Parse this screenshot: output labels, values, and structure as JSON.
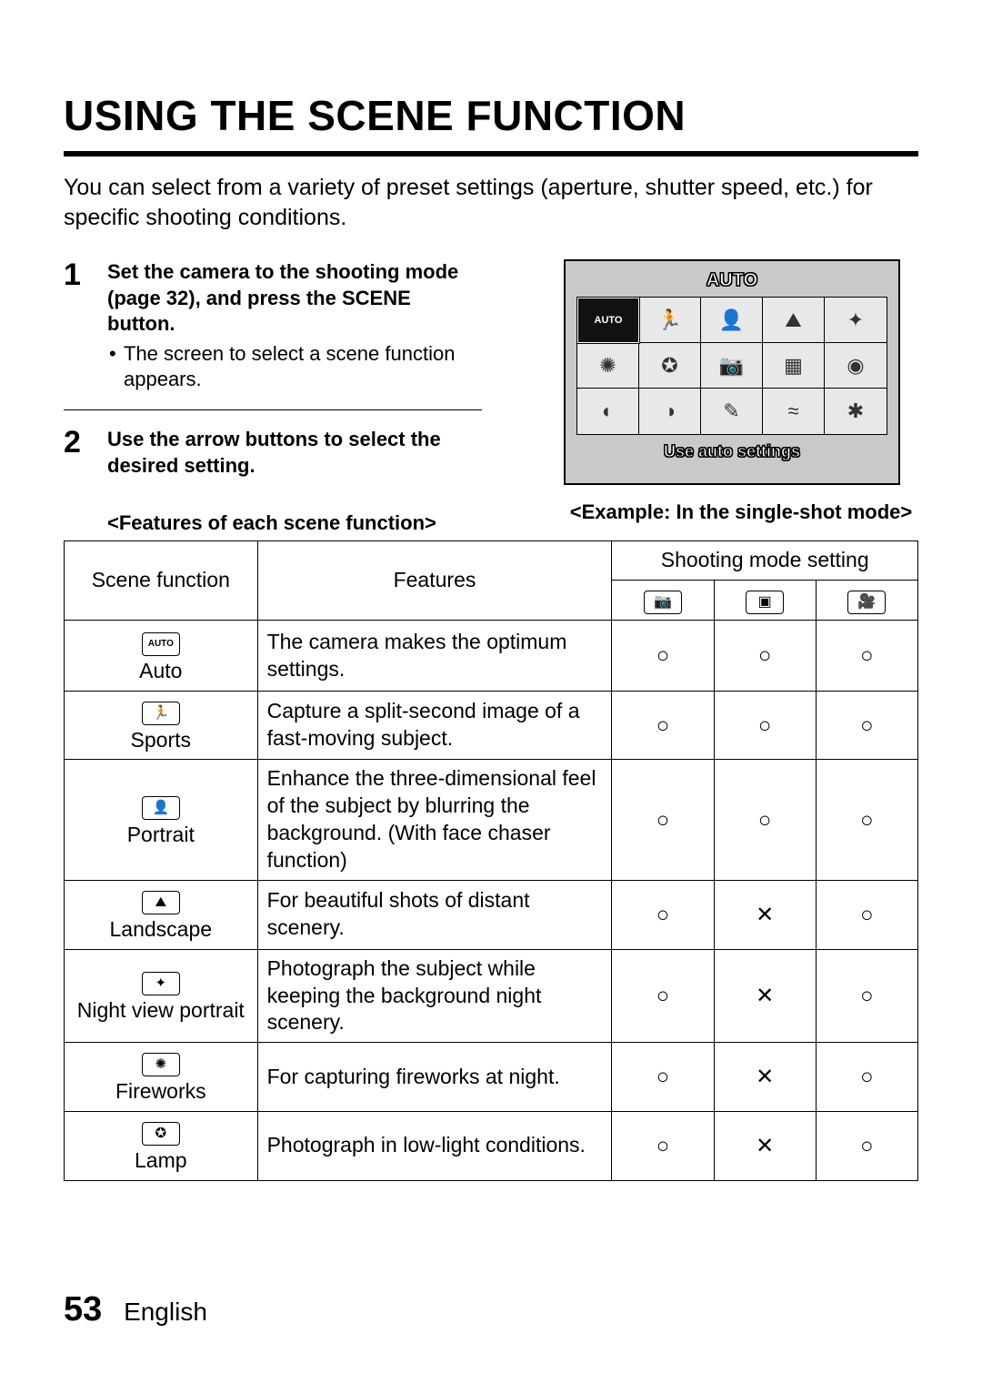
{
  "title": "USING THE SCENE FUNCTION",
  "intro": "You can select from a variety of preset settings (aperture, shutter speed, etc.) for specific shooting conditions.",
  "steps": [
    {
      "num": "1",
      "head": "Set the camera to the shooting mode (page 32), and press the SCENE button.",
      "sub": "The screen to select a scene function appears."
    },
    {
      "num": "2",
      "head": "Use the arrow buttons to select the desired setting."
    }
  ],
  "figure": {
    "header_label": "AUTO",
    "selected_label": "AUTO",
    "footer_label": "Use auto settings",
    "caption": "<Example: In the single-shot mode>",
    "grid_glyphs": [
      "",
      "🏃",
      "👤",
      "⛰",
      "✦",
      "✺",
      "✪",
      "📷",
      "▦",
      "◉",
      "◐",
      "◑",
      "✎",
      "≈",
      "✱"
    ]
  },
  "table_caption": "<Features of each scene function>",
  "table": {
    "head": {
      "scene": "Scene function",
      "features": "Features",
      "modes": "Shooting mode setting"
    },
    "mode_icons": [
      "📷",
      "▣",
      "🎥"
    ],
    "marks": {
      "yes": "○",
      "no": "✕"
    },
    "rows": [
      {
        "icon_text": "AUTO",
        "icon_is_text": true,
        "name": "Auto",
        "feature": "The camera makes the optimum settings.",
        "m": [
          "yes",
          "yes",
          "yes"
        ]
      },
      {
        "icon_text": "🏃",
        "name": "Sports",
        "feature": "Capture a split-second image of a fast-moving subject.",
        "m": [
          "yes",
          "yes",
          "yes"
        ]
      },
      {
        "icon_text": "👤",
        "name": "Portrait",
        "feature": "Enhance the three-dimensional feel of the subject by blurring the background. (With face chaser function)",
        "m": [
          "yes",
          "yes",
          "yes"
        ]
      },
      {
        "icon_text": "⛰",
        "name": "Landscape",
        "feature": "For beautiful shots of distant scenery.",
        "m": [
          "yes",
          "no",
          "yes"
        ]
      },
      {
        "icon_text": "✦",
        "name": "Night view portrait",
        "feature": "Photograph the subject while keeping the background night scenery.",
        "m": [
          "yes",
          "no",
          "yes"
        ]
      },
      {
        "icon_text": "✺",
        "name": "Fireworks",
        "feature": "For capturing fireworks at night.",
        "m": [
          "yes",
          "no",
          "yes"
        ]
      },
      {
        "icon_text": "✪",
        "name": "Lamp",
        "feature": "Photograph in low-light conditions.",
        "m": [
          "yes",
          "no",
          "yes"
        ]
      }
    ]
  },
  "footer": {
    "page": "53",
    "lang": "English"
  }
}
